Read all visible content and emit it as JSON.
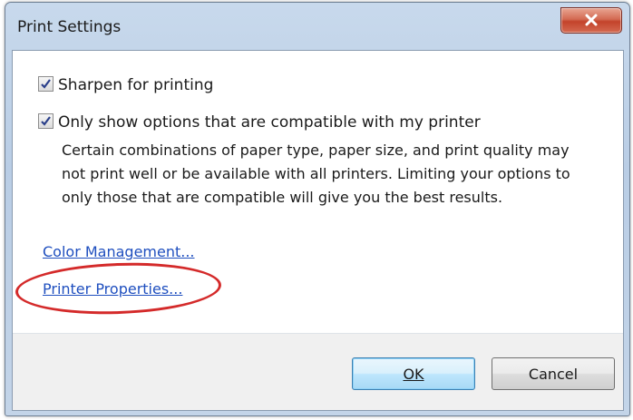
{
  "window": {
    "title": "Print Settings"
  },
  "options": {
    "sharpen_label": "Sharpen for printing",
    "sharpen_checked": true,
    "compatible_label": "Only show options that are compatible with my printer",
    "compatible_checked": true,
    "compatible_desc_lines": [
      "Certain combinations of paper type, paper size, and print quality may",
      "not print well or be available with all printers.  Limiting your options to",
      "only those that are compatible will give you the best results."
    ]
  },
  "links": {
    "color_management": "Color Management...",
    "printer_properties": "Printer Properties..."
  },
  "buttons": {
    "ok": "OK",
    "cancel": "Cancel"
  },
  "colors": {
    "annotation_circle": "#d42a2a",
    "link": "#1f4fbf"
  },
  "icons": {
    "close": "close-icon",
    "checkbox": "checkmark-icon"
  }
}
